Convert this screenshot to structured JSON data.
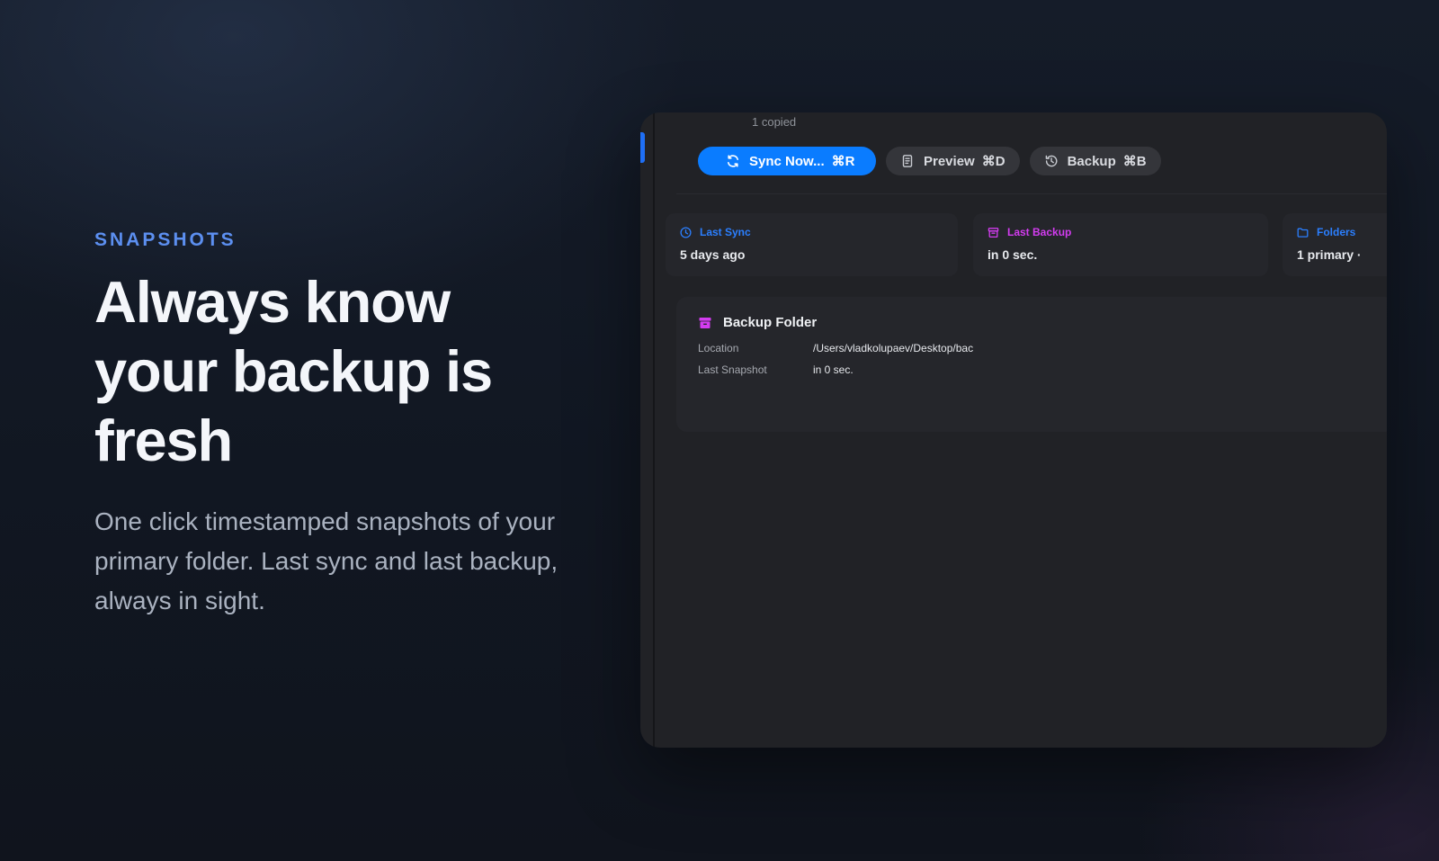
{
  "hero": {
    "eyebrow": "SNAPSHOTS",
    "headline": "Always know your backup is fresh",
    "body": "One click timestamped snapshots of your primary folder. Last sync and last backup, always in sight."
  },
  "window": {
    "status_text": "1 copied",
    "toolbar": {
      "sync": {
        "label": "Sync Now...",
        "shortcut": "⌘R",
        "icon": "sync-icon"
      },
      "preview": {
        "label": "Preview",
        "shortcut": "⌘D",
        "icon": "document-icon"
      },
      "backup": {
        "label": "Backup",
        "shortcut": "⌘B",
        "icon": "history-icon"
      }
    },
    "stats": [
      {
        "title": "Last Sync",
        "value": "5 days ago",
        "icon": "clock-icon",
        "color": "#2b7fff"
      },
      {
        "title": "Last Backup",
        "value": "in 0 sec.",
        "icon": "archive-icon",
        "color": "#d33cf0"
      },
      {
        "title": "Folders",
        "value": "1 primary ·",
        "icon": "folder-icon",
        "color": "#2b7fff"
      }
    ],
    "backup_folder": {
      "title": "Backup Folder",
      "icon": "archive-icon",
      "location_label": "Location",
      "location_value": "/Users/vladkolupaev/Desktop/bac",
      "snapshot_label": "Last Snapshot",
      "snapshot_value": "in 0 sec."
    }
  },
  "colors": {
    "accent_blue": "#0a7cff",
    "eyebrow_blue": "#5c8ff0",
    "magenta": "#d33cf0",
    "window_bg": "#212226"
  }
}
